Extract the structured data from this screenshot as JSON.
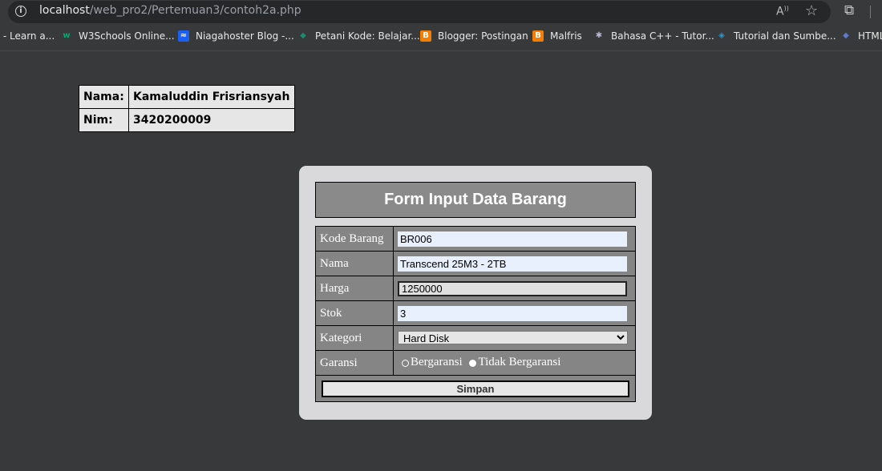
{
  "browser": {
    "url_host": "localhost",
    "url_path": "/web_pro2/Pertemuan3/contoh2a.php",
    "bookmarks": [
      {
        "label": "| - Learn a...",
        "icon": "generic-icon",
        "color": "#555555"
      },
      {
        "label": "W3Schools Online...",
        "icon": "w3schools-icon",
        "color": "#04aa6d"
      },
      {
        "label": "Niagahoster Blog -...",
        "icon": "niagahoster-icon",
        "color": "#1b60f2"
      },
      {
        "label": "Petani Kode: Belajar...",
        "icon": "petanikode-icon",
        "color": "#1e8a6e"
      },
      {
        "label": "Blogger: Postingan",
        "icon": "blogger-icon",
        "color": "#f57d00"
      },
      {
        "label": "Malfris",
        "icon": "blogger-icon",
        "color": "#f57d00"
      },
      {
        "label": "Bahasa C++ - Tutor...",
        "icon": "cpp-icon",
        "color": "#8e8ea8"
      },
      {
        "label": "Tutorial dan Sumbe...",
        "icon": "tutorial-icon",
        "color": "#2e9ad0"
      },
      {
        "label": "HTML",
        "icon": "html-icon",
        "color": "#3b5ba8"
      }
    ]
  },
  "identity": {
    "name_label": "Nama:",
    "name_value": "Kamaluddin Frisriansyah",
    "nim_label": "Nim:",
    "nim_value": "3420200009"
  },
  "form": {
    "title": "Form Input Data Barang",
    "kode_label": "Kode Barang",
    "kode_value": "BR006",
    "nama_label": "Nama",
    "nama_value": "Transcend 25M3 - 2TB",
    "harga_label": "Harga",
    "harga_value": "1250000",
    "stok_label": "Stok",
    "stok_value": "3",
    "kategori_label": "Kategori",
    "kategori_value": "Hard Disk",
    "garansi_label": "Garansi",
    "garansi_options": [
      "Bergaransi",
      "Tidak Bergaransi"
    ],
    "garansi_selected": "Tidak Bergaransi",
    "submit_label": "Simpan"
  }
}
